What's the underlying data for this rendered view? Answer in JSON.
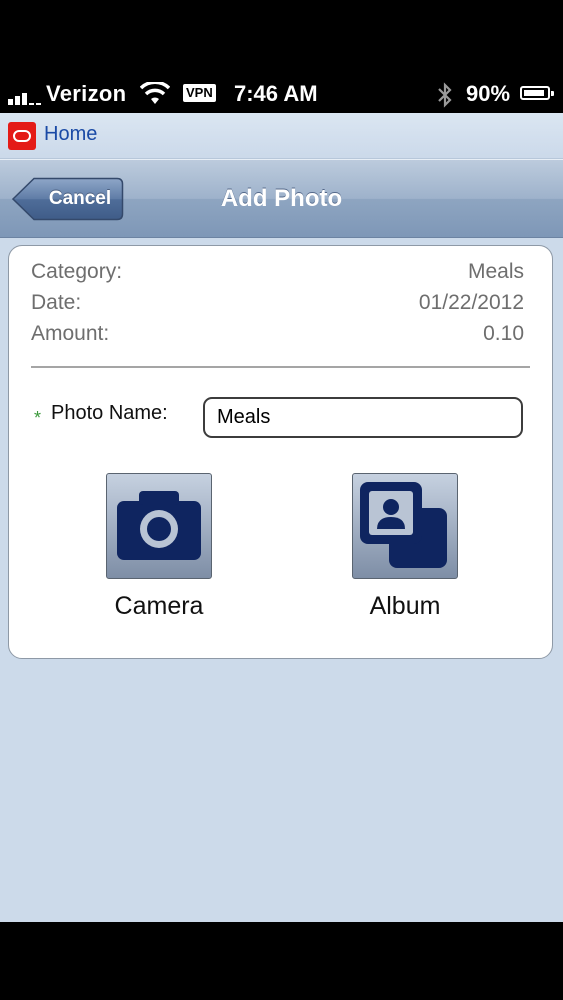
{
  "status_bar": {
    "carrier": "Verizon",
    "vpn": "VPN",
    "time": "7:46 AM",
    "battery_percent": "90%",
    "battery_level": 0.9,
    "icons": [
      "signal-bars-icon",
      "wifi-icon",
      "bluetooth-icon",
      "battery-icon"
    ]
  },
  "home_bar": {
    "link": "Home",
    "logo_icon": "oracle-logo-icon"
  },
  "nav": {
    "cancel": "Cancel",
    "title": "Add Photo"
  },
  "details": [
    {
      "label": "Category:",
      "value": "Meals"
    },
    {
      "label": "Date:",
      "value": "01/22/2012"
    },
    {
      "label": "Amount:",
      "value": "0.10"
    }
  ],
  "form": {
    "required_marker": "*",
    "photo_name_label": "Photo Name:",
    "photo_name_value": "Meals"
  },
  "actions": {
    "camera": {
      "label": "Camera",
      "icon": "camera-icon"
    },
    "album": {
      "label": "Album",
      "icon": "photo-album-icon"
    }
  },
  "colors": {
    "link": "#1a4aa6",
    "nav_bar": "#8ea5c1",
    "background": "#ccdaea",
    "required": "#3b9a3b",
    "icon_navy": "#0f2560"
  }
}
